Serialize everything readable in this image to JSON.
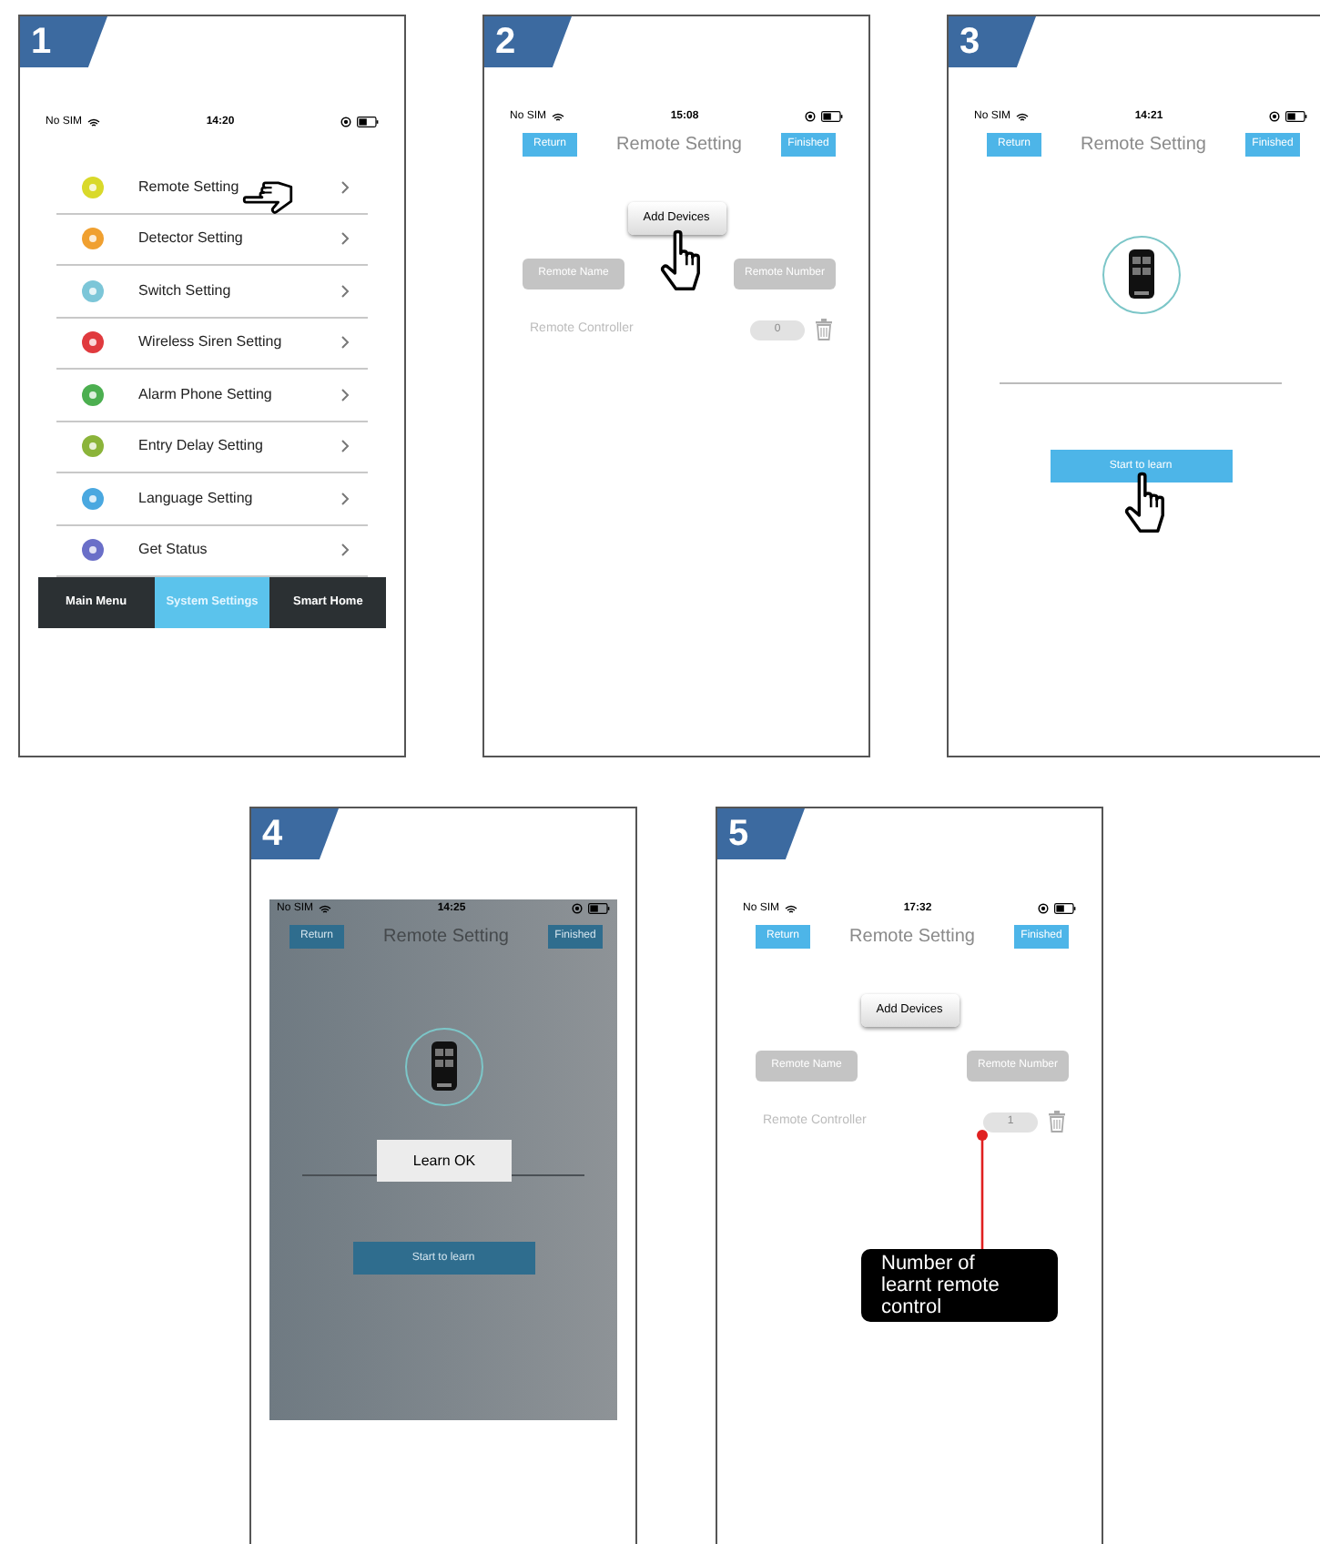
{
  "steps": [
    {
      "number": "1",
      "kind": "menu",
      "pointer": true,
      "status_bar": {
        "carrier": "No SIM",
        "time": "14:20"
      },
      "menu_items": [
        {
          "label": "Remote Setting",
          "color": "#d9d92a"
        },
        {
          "label": "Detector Setting",
          "color": "#f0a030"
        },
        {
          "label": "Switch Setting",
          "color": "#7cc6d8"
        },
        {
          "label": "Wireless Siren Setting",
          "color": "#e03a3e"
        },
        {
          "label": "Alarm Phone Setting",
          "color": "#4caf50"
        },
        {
          "label": "Entry Delay Setting",
          "color": "#8bb43a"
        },
        {
          "label": "Language Setting",
          "color": "#4aa8e0"
        },
        {
          "label": "Get Status",
          "color": "#6a6fc8"
        }
      ],
      "tabs": [
        {
          "label": "Main Menu",
          "selected": false
        },
        {
          "label": "System Settings",
          "selected": true
        },
        {
          "label": "Smart Home",
          "selected": false
        }
      ]
    },
    {
      "number": "2",
      "kind": "device_list",
      "pointer": true,
      "status_bar": {
        "carrier": "No SIM",
        "time": "15:08"
      },
      "header": {
        "back": "Return",
        "title": "Remote Setting",
        "done": "Finished"
      },
      "add_button": "Add Devices",
      "columns": [
        "Remote Name",
        "Remote Number"
      ],
      "rows": [
        {
          "name": "Remote Controller",
          "count": "0"
        }
      ]
    },
    {
      "number": "3",
      "kind": "learn",
      "pointer": true,
      "dimmed": false,
      "status_bar": {
        "carrier": "No SIM",
        "time": "14:21"
      },
      "header": {
        "back": "Return",
        "title": "Remote Setting",
        "done": "Finished"
      },
      "learn_button": "Start to learn"
    },
    {
      "number": "4",
      "kind": "learn",
      "pointer": false,
      "dimmed": true,
      "status_bar": {
        "carrier": "No SIM",
        "time": "14:25"
      },
      "header": {
        "back": "Return",
        "title": "Remote Setting",
        "done": "Finished"
      },
      "learn_button": "Start to learn",
      "dialog": "Learn OK"
    },
    {
      "number": "5",
      "kind": "device_list",
      "pointer": false,
      "status_bar": {
        "carrier": "No SIM",
        "time": "17:32"
      },
      "header": {
        "back": "Return",
        "title": "Remote Setting",
        "done": "Finished"
      },
      "add_button": "Add Devices",
      "columns": [
        "Remote Name",
        "Remote Number"
      ],
      "rows": [
        {
          "name": "Remote Controller",
          "count": "1"
        }
      ],
      "callout": "Number of learnt remote control"
    }
  ]
}
